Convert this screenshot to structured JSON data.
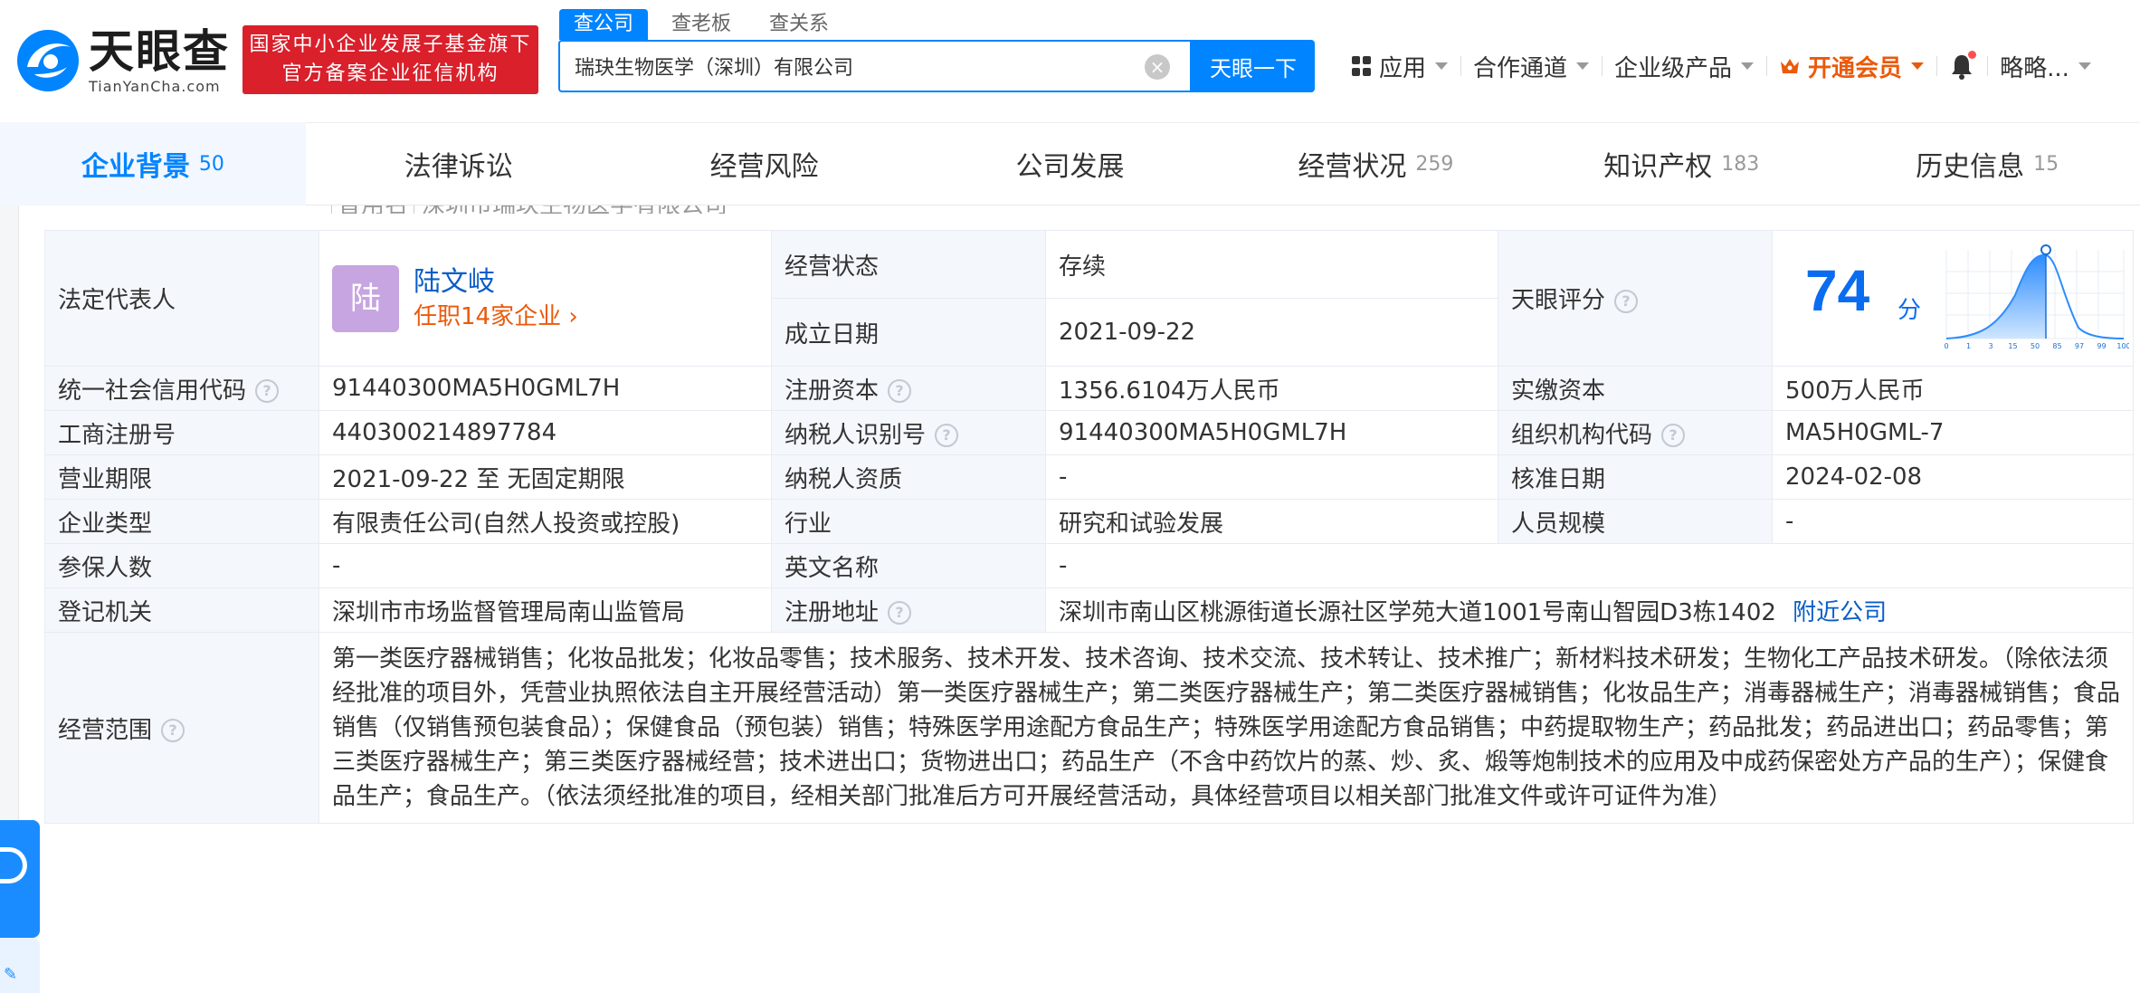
{
  "header": {
    "logo_cn": "天眼查",
    "logo_en": "TianYanCha.com",
    "promo_line1": "国家中小企业发展子基金旗下",
    "promo_line2": "官方备案企业征信机构",
    "search_tabs": [
      "查公司",
      "查老板",
      "查关系"
    ],
    "search_value": "瑞玦生物医学（深圳）有限公司",
    "search_button": "天眼一下",
    "nav": {
      "apps": "应用",
      "partner": "合作通道",
      "enterprise": "企业级产品",
      "vip": "开通会员",
      "user": "略略..."
    },
    "colors": {
      "brand": "#0084ff",
      "promo": "#d9202b",
      "vip": "#ea5a0b"
    }
  },
  "tabs": [
    {
      "label": "企业背景",
      "count": "50"
    },
    {
      "label": "法律诉讼",
      "count": ""
    },
    {
      "label": "经营风险",
      "count": ""
    },
    {
      "label": "公司发展",
      "count": ""
    },
    {
      "label": "经营状况",
      "count": "259"
    },
    {
      "label": "知识产权",
      "count": "183"
    },
    {
      "label": "历史信息",
      "count": "15"
    }
  ],
  "peek": {
    "tag": "曾用名",
    "text": "深圳市瑞玦生物医学有限公司"
  },
  "info": {
    "legal_rep_label": "法定代表人",
    "legal_rep_avatar": "陆",
    "legal_rep_name": "陆文岐",
    "legal_rep_roles": "任职14家企业",
    "status_label": "经营状态",
    "status_value": "存续",
    "founded_label": "成立日期",
    "founded_value": "2021-09-22",
    "score_label": "天眼评分",
    "score_value": "74",
    "score_unit": "分",
    "score_ticks": [
      "0",
      "1",
      "3",
      "15",
      "50",
      "85",
      "97",
      "99",
      "100"
    ],
    "credit_code_label": "统一社会信用代码",
    "credit_code_value": "91440300MA5H0GML7H",
    "reg_capital_label": "注册资本",
    "reg_capital_value": "1356.6104万人民币",
    "paid_capital_label": "实缴资本",
    "paid_capital_value": "500万人民币",
    "biz_reg_no_label": "工商注册号",
    "biz_reg_no_value": "440300214897784",
    "taxpayer_id_label": "纳税人识别号",
    "taxpayer_id_value": "91440300MA5H0GML7H",
    "org_code_label": "组织机构代码",
    "org_code_value": "MA5H0GML-7",
    "term_label": "营业期限",
    "term_value": "2021-09-22 至 无固定期限",
    "taxpayer_qual_label": "纳税人资质",
    "taxpayer_qual_value": "-",
    "approved_label": "核准日期",
    "approved_value": "2024-02-08",
    "type_label": "企业类型",
    "type_value": "有限责任公司(自然人投资或控股)",
    "industry_label": "行业",
    "industry_value": "研究和试验发展",
    "staff_label": "人员规模",
    "staff_value": "-",
    "insured_label": "参保人数",
    "insured_value": "-",
    "english_label": "英文名称",
    "english_value": "-",
    "authority_label": "登记机关",
    "authority_value": "深圳市市场监督管理局南山监管局",
    "address_label": "注册地址",
    "address_value": "深圳市南山区桃源街道长源社区学苑大道1001号南山智园D3栋1402",
    "nearby_link": "附近公司",
    "scope_label": "经营范围",
    "scope_value": "第一类医疗器械销售；化妆品批发；化妆品零售；技术服务、技术开发、技术咨询、技术交流、技术转让、技术推广；新材料技术研发；生物化工产品技术研发。（除依法须经批准的项目外，凭营业执照依法自主开展经营活动）第一类医疗器械生产；第二类医疗器械生产；第二类医疗器械销售；化妆品生产；消毒器械生产；消毒器械销售；食品销售（仅销售预包装食品）；保健食品（预包装）销售；特殊医学用途配方食品生产；特殊医学用途配方食品销售；中药提取物生产；药品批发；药品进出口；药品零售；第三类医疗器械生产；第三类医疗器械经营；技术进出口；货物进出口；药品生产（不含中药饮片的蒸、炒、炙、煅等炮制技术的应用及中成药保密处方产品的生产）；保健食品生产；食品生产。（依法须经批准的项目，经相关部门批准后方可开展经营活动，具体经营项目以相关部门批准文件或许可证件为准）"
  }
}
